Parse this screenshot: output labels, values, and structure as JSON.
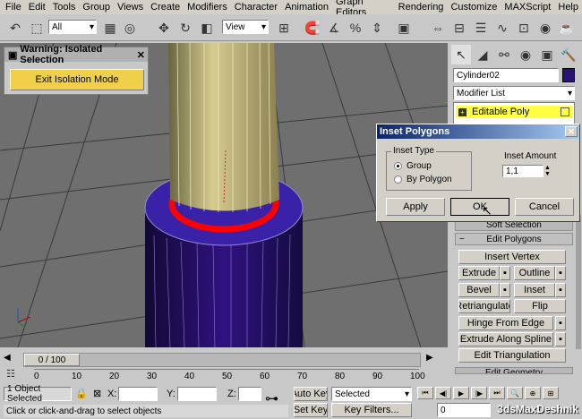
{
  "menu": [
    "File",
    "Edit",
    "Tools",
    "Group",
    "Views",
    "Create",
    "Modifiers",
    "Character",
    "Animation",
    "Graph Editors",
    "Rendering",
    "Customize",
    "MAXScript",
    "Help"
  ],
  "toolbar": {
    "selection_filter": "All",
    "ref_coord": "View"
  },
  "warning": {
    "title": "Warning: Isolated Selection",
    "button": "Exit Isolation Mode"
  },
  "dialog": {
    "title": "Inset Polygons",
    "group_label": "Inset Type",
    "radio_group": "Group",
    "radio_by_polygon": "By Polygon",
    "amount_label": "Inset Amount",
    "amount_value": "1,1",
    "apply": "Apply",
    "ok": "OK",
    "cancel": "Cancel"
  },
  "panel": {
    "object_name": "Cylinder02",
    "modifier_list": "Modifier List",
    "stack_item": "Editable Poly",
    "rollout_soft": "Soft Selection",
    "rollout_edit": "Edit Polygons",
    "insert_vertex": "Insert Vertex",
    "extrude": "Extrude",
    "outline": "Outline",
    "bevel": "Bevel",
    "inset": "Inset",
    "retriangulate": "Retriangulate",
    "flip": "Flip",
    "hinge": "Hinge From Edge",
    "extrude_spline": "Extrude Along Spline",
    "edit_triangulation": "Edit Triangulation",
    "rollout_edit_geometry": "Edit Geometry"
  },
  "timeline": {
    "frame": "0 / 100",
    "ticks": [
      "0",
      "10",
      "20",
      "30",
      "40",
      "50",
      "60",
      "70",
      "80",
      "90",
      "100"
    ]
  },
  "status": {
    "selected_count": "1 Object Selected",
    "x_label": "X:",
    "y_label": "Y:",
    "z_label": "Z:",
    "auto_key": "Auto Key",
    "selected": "Selected",
    "set_key": "Set Key",
    "key_filters": "Key Filters...",
    "prompt": "Click or click-and-drag to select objects",
    "frame_field": "0",
    "watermark": "3dsMaxDeshnik"
  },
  "colors": {
    "accent_yellow": "#f0d048",
    "selection_red": "#ff0000",
    "cylinder_blue": "#2a1270",
    "dialog_title": "#0a246a"
  }
}
